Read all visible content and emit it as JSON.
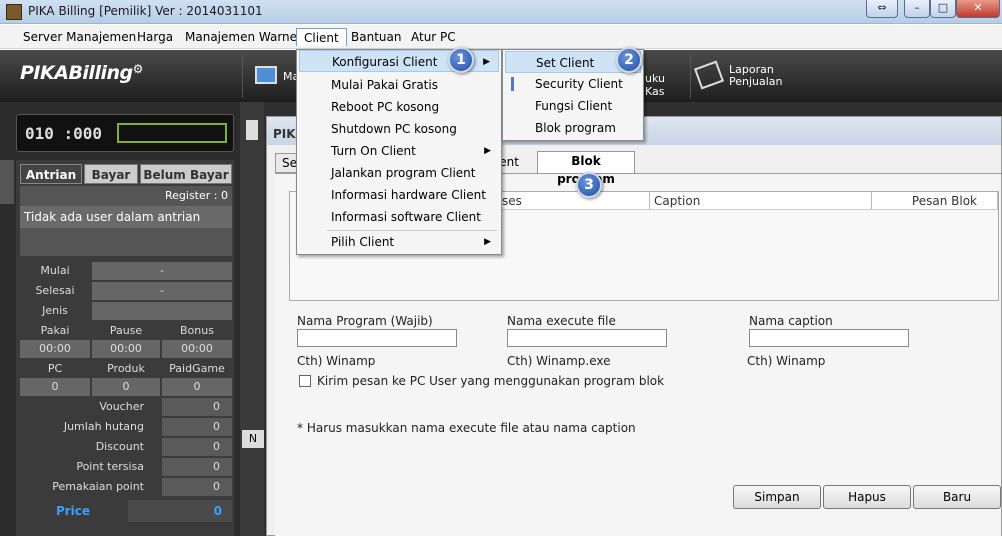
{
  "window": {
    "title": "PIKA Billing [Pemilik]  Ver : 2014031101"
  },
  "menubar": [
    "Server Manajemen",
    "Harga",
    "Manajemen Warnet",
    "Client",
    "Bantuan",
    "Atur PC"
  ],
  "header": {
    "logo_a": "PIKA",
    "logo_b": "Billing",
    "monitor_label": "Ma",
    "kas_label": "uku Kas",
    "laporan_label": "Laporan Penjualan"
  },
  "counter": {
    "value": "010 :000"
  },
  "left_tabs": [
    "Antrian",
    "Bayar",
    "Belum Bayar"
  ],
  "register": "Register : 0",
  "queue_message": "Tidak ada user dalam antrian",
  "session": {
    "mulai": {
      "label": "Mulai",
      "value": "-"
    },
    "selesai": {
      "label": "Selesai",
      "value": "-"
    },
    "jenis": {
      "label": "Jenis",
      "value": ""
    }
  },
  "stats_row1": {
    "labels": [
      "Pakai",
      "Pause",
      "Bonus"
    ],
    "values": [
      "00:00",
      "00:00",
      "00:00"
    ]
  },
  "stats_row2": {
    "labels": [
      "PC",
      "Produk",
      "PaidGame"
    ],
    "values": [
      "0",
      "0",
      "0"
    ]
  },
  "summary": [
    {
      "label": "Voucher",
      "value": "0"
    },
    {
      "label": "Jumlah hutang",
      "value": "0"
    },
    {
      "label": "Discount",
      "value": "0"
    },
    {
      "label": "Point tersisa",
      "value": "0"
    },
    {
      "label": "Pemakaian point",
      "value": "0"
    }
  ],
  "price": {
    "label": "Price",
    "value": "0"
  },
  "midstrip_n": "N",
  "dialog": {
    "title": "PIKA",
    "tabs": [
      "Set",
      "ient",
      "Blok program"
    ],
    "columns": [
      "roses",
      "Caption",
      "Pesan Blok"
    ],
    "field1_label": "Nama Program (Wajib)",
    "field2_label": "Nama execute file",
    "field3_label": "Nama caption",
    "ex1": "Cth) Winamp",
    "ex2": "Cth) Winamp.exe",
    "ex3": "Cth) Winamp",
    "checkbox_label": "Kirim pesan ke PC User yang menggunakan program blok",
    "note": "* Harus masukkan nama execute file atau nama caption",
    "buttons": [
      "Simpan",
      "Hapus",
      "Baru"
    ]
  },
  "client_menu": [
    "Konfigurasi Client",
    "Mulai Pakai Gratis",
    "Reboot PC kosong",
    "Shutdown PC kosong",
    "Turn On Client",
    "Jalankan program Client",
    "Informasi hardware Client",
    "Informasi software Client",
    "Pilih Client"
  ],
  "submenu": [
    "Set Client",
    "Security Client",
    "Fungsi Client",
    "Blok program"
  ],
  "badges": [
    "1",
    "2",
    "3"
  ],
  "window_buttons": {
    "restore": "⇔",
    "minimize": "–",
    "maximize": "□",
    "close": "✕"
  }
}
